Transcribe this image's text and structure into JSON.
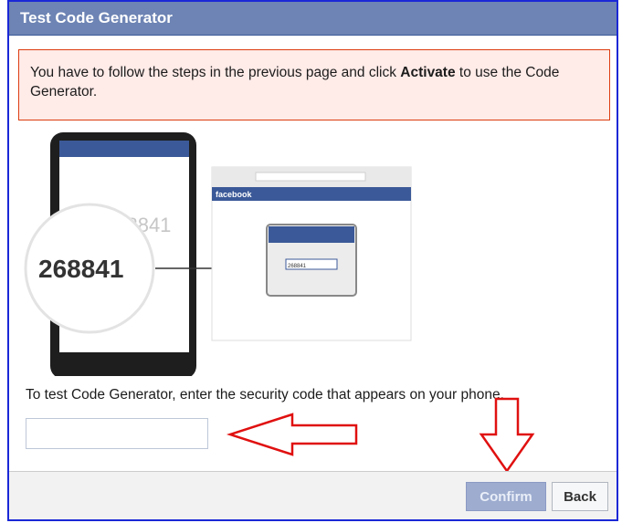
{
  "dialog": {
    "title": "Test Code Generator",
    "alert_text_before": "You have to follow the steps in the previous page and click ",
    "alert_bold": "Activate",
    "alert_text_after": " to use the Code Generator."
  },
  "illustration": {
    "code_big": "268841",
    "code_phone": "268841",
    "code_box": "268841",
    "browser_brand": "facebook"
  },
  "instructions": "To test Code Generator, enter the security code that appears on your phone.",
  "code_input": {
    "value": "",
    "placeholder": ""
  },
  "buttons": {
    "confirm": "Confirm",
    "back": "Back"
  },
  "colors": {
    "header": "#6d84b4",
    "alert_bg": "#ffebe8",
    "alert_border": "#dd3c10",
    "annotation_red": "#e01010",
    "frame_blue": "#1a28d6"
  }
}
